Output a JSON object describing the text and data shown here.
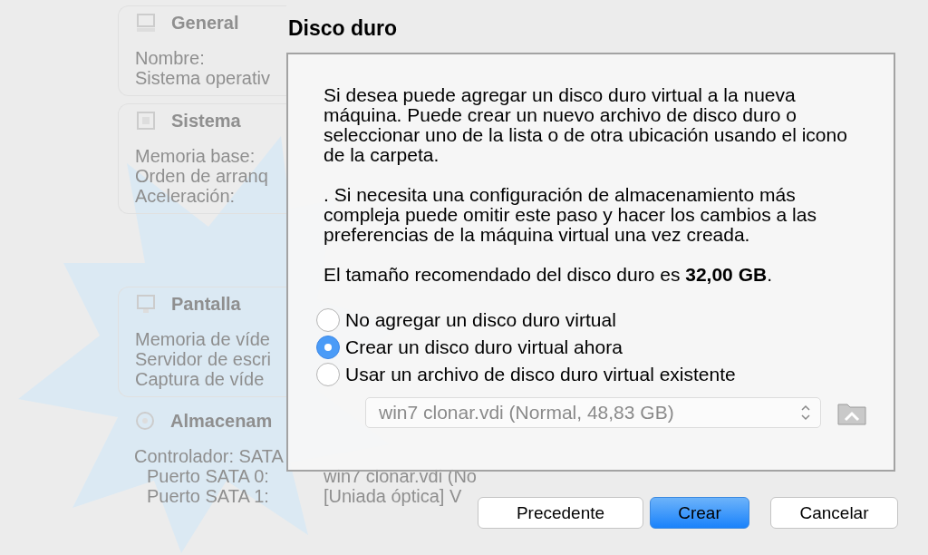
{
  "background": {
    "sections": [
      {
        "kind": "general",
        "title": "General",
        "rows": [
          {
            "label": "Nombre:"
          },
          {
            "label": "Sistema operativ"
          }
        ]
      },
      {
        "kind": "system",
        "title": "Sistema",
        "rows": [
          {
            "label": "Memoria base:"
          },
          {
            "label": "Orden de arranq"
          },
          {
            "label": "Aceleración:"
          }
        ]
      },
      {
        "kind": "display",
        "title": "Pantalla",
        "rows": [
          {
            "label": "Memoria de víde"
          },
          {
            "label": "Servidor de escri"
          },
          {
            "label": "Captura de víde"
          }
        ]
      },
      {
        "kind": "storage",
        "title": "Almacenam",
        "rows": [
          {
            "label": "Controlador: SATA"
          },
          {
            "label": "Puerto SATA 0:",
            "value": "win7 clonar.vdi (No"
          },
          {
            "label": "Puerto SATA 1:",
            "value": "[Uniada óptica] V"
          }
        ]
      }
    ]
  },
  "dialog": {
    "title": "Disco duro",
    "paragraphs": [
      "Si desea puede agregar un disco duro virtual a la nueva máquina. Puede crear un nuevo archivo de disco duro o seleccionar uno de la lista o de otra ubicación usando el icono de la carpeta.",
      ". Si necesita una configuración de almacenamiento más compleja puede omitir este paso y hacer los cambios a las preferencias de la máquina virtual una vez creada.",
      "El tamaño recomendado del disco duro es **32,00 GB**."
    ],
    "options": [
      {
        "label": "No agregar un disco duro virtual",
        "selected": false
      },
      {
        "label": "Crear un disco duro virtual ahora",
        "selected": true
      },
      {
        "label": "Usar un archivo de disco duro virtual existente",
        "selected": false
      }
    ],
    "disk_select": {
      "value": "win7 clonar.vdi (Normal, 48,83 GB)",
      "disabled": true
    },
    "buttons": [
      {
        "label": "Precedente",
        "kind": "normal"
      },
      {
        "label": "Crear",
        "kind": "default"
      },
      {
        "label": "Cancelar",
        "kind": "normal"
      }
    ]
  }
}
